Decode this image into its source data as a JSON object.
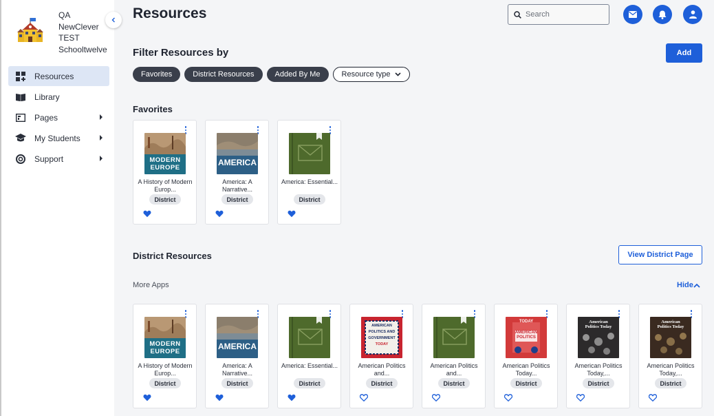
{
  "school": {
    "name_lines": [
      "QA",
      "NewClever",
      "TEST",
      "Schooltwelve"
    ]
  },
  "sidebar": {
    "items": [
      {
        "label": "Resources",
        "icon": "grid-plus-icon",
        "active": true
      },
      {
        "label": "Library",
        "icon": "book-open-icon"
      },
      {
        "label": "Pages",
        "icon": "page-icon",
        "has_submenu": true
      },
      {
        "label": "My Students",
        "icon": "graduation-cap-icon",
        "has_submenu": true
      },
      {
        "label": "Support",
        "icon": "lifebuoy-icon",
        "has_submenu": true
      }
    ]
  },
  "header": {
    "title": "Resources",
    "search_placeholder": "Search"
  },
  "filter": {
    "title": "Filter Resources by",
    "add_label": "Add",
    "pills": [
      "Favorites",
      "District Resources",
      "Added By Me"
    ],
    "resource_type_label": "Resource type"
  },
  "favorites": {
    "title": "Favorites",
    "cards": [
      {
        "title": "A History of Modern Europ...",
        "badge": "District",
        "cover": "europe",
        "favorited": true
      },
      {
        "title": "America: A Narrative...",
        "badge": "District",
        "cover": "america",
        "favorited": true
      },
      {
        "title": "America: Essential...",
        "badge": "District",
        "cover": "green",
        "favorited": true
      }
    ]
  },
  "district": {
    "title": "District Resources",
    "view_page_label": "View District Page",
    "more_apps_label": "More Apps",
    "hide_label": "Hide",
    "cards": [
      {
        "title": "A History of Modern Europ...",
        "badge": "District",
        "cover": "europe",
        "favorited": true
      },
      {
        "title": "America: A Narrative...",
        "badge": "District",
        "cover": "america",
        "favorited": true
      },
      {
        "title": "America: Essential...",
        "badge": "District",
        "cover": "green",
        "favorited": true
      },
      {
        "title": "American Politics and...",
        "badge": "District",
        "cover": "politics",
        "favorited": false
      },
      {
        "title": "American Politics and...",
        "badge": "District",
        "cover": "green",
        "favorited": false
      },
      {
        "title": "American Politics Today...",
        "badge": "District",
        "cover": "today",
        "favorited": false
      },
      {
        "title": "American Politics Today,...",
        "badge": "District",
        "cover": "dark",
        "favorited": false
      },
      {
        "title": "American Politics Today,...",
        "badge": "District",
        "cover": "dark2",
        "favorited": false
      }
    ]
  },
  "cover_text": {
    "europe": [
      "MODERN",
      "EUROPE"
    ],
    "america": [
      "AMERICA"
    ],
    "politics": [
      "AMERICAN",
      "POLITICS AND",
      "GOVERNMENT",
      "TODAY"
    ],
    "today": [
      "AMERICAN",
      "POLITICS",
      "TODAY"
    ],
    "dark": [
      "American",
      "Politics Today"
    ],
    "dark2": [
      "American",
      "Politics Today"
    ]
  },
  "colors": {
    "accent": "#1e5fd9",
    "pill_dark": "#3a3f4b",
    "active_nav": "#dde6f5"
  }
}
